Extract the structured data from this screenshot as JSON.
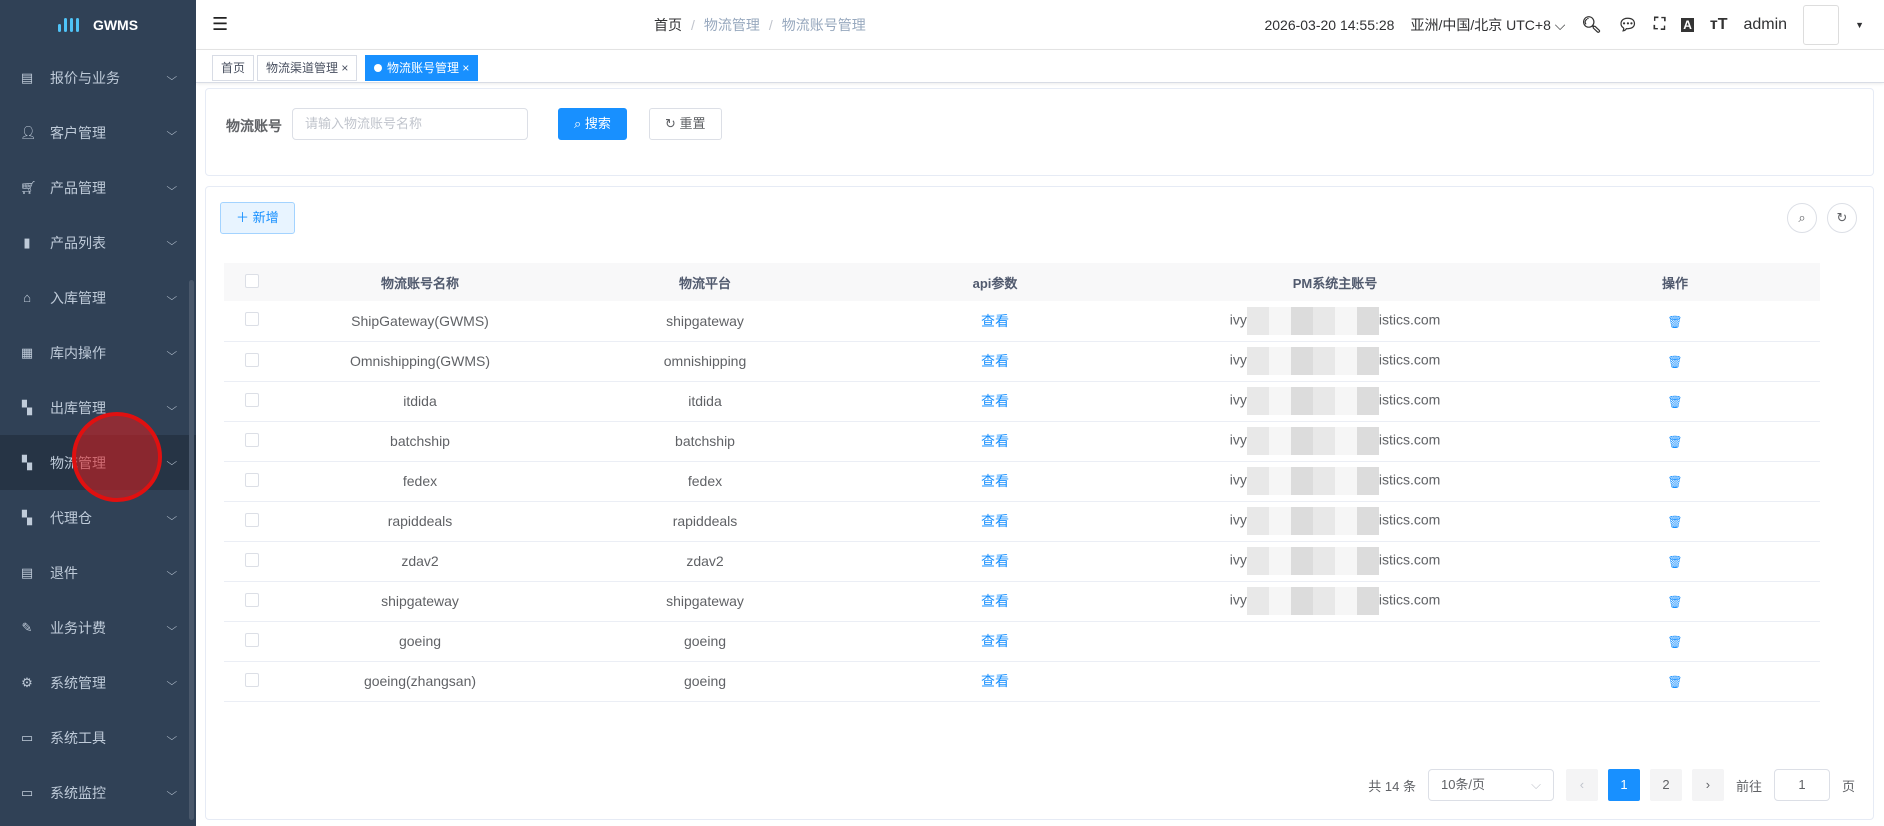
{
  "app": {
    "name": "GWMS"
  },
  "sidebar": {
    "items": [
      {
        "label": "报价与业务",
        "icon": "quote-icon"
      },
      {
        "label": "客户管理",
        "icon": "user-icon"
      },
      {
        "label": "产品管理",
        "icon": "cart-icon"
      },
      {
        "label": "产品列表",
        "icon": "book-icon"
      },
      {
        "label": "入库管理",
        "icon": "home-icon"
      },
      {
        "label": "库内操作",
        "icon": "grid-icon"
      },
      {
        "label": "出库管理",
        "icon": "apps-icon"
      },
      {
        "label": "物流管理",
        "icon": "apps-icon"
      },
      {
        "label": "代理仓",
        "icon": "apps-icon"
      },
      {
        "label": "退件",
        "icon": "return-icon"
      },
      {
        "label": "业务计费",
        "icon": "edit-icon"
      },
      {
        "label": "系统管理",
        "icon": "gear-icon"
      },
      {
        "label": "系统工具",
        "icon": "toolbox-icon"
      },
      {
        "label": "系统监控",
        "icon": "monitor-icon"
      }
    ]
  },
  "header": {
    "breadcrumb": [
      "首页",
      "物流管理",
      "物流账号管理"
    ],
    "datetime": "2026-03-20 14:55:28",
    "timezone": "亚洲/中国/北京 UTC+8",
    "user": "admin"
  },
  "tabs": [
    {
      "label": "首页"
    },
    {
      "label": "物流渠道管理"
    },
    {
      "label": "物流账号管理"
    }
  ],
  "search": {
    "label": "物流账号",
    "placeholder": "请输入物流账号名称",
    "search_btn": "搜索",
    "reset_btn": "重置"
  },
  "toolbar": {
    "add_btn": "新增"
  },
  "table": {
    "columns": [
      "物流账号名称",
      "物流平台",
      "api参数",
      "PM系统主账号",
      "操作"
    ],
    "rows": [
      {
        "name": "ShipGateway(GWMS)",
        "platform": "shipgateway",
        "api": "查看",
        "pm_prefix": "ivy",
        "pm_suffix": "istics.com"
      },
      {
        "name": "Omnishipping(GWMS)",
        "platform": "omnishipping",
        "api": "查看",
        "pm_prefix": "ivy",
        "pm_suffix": "istics.com"
      },
      {
        "name": "itdida",
        "platform": "itdida",
        "api": "查看",
        "pm_prefix": "ivy",
        "pm_suffix": "istics.com"
      },
      {
        "name": "batchship",
        "platform": "batchship",
        "api": "查看",
        "pm_prefix": "ivy",
        "pm_suffix": "istics.com"
      },
      {
        "name": "fedex",
        "platform": "fedex",
        "api": "查看",
        "pm_prefix": "ivy",
        "pm_suffix": "istics.com"
      },
      {
        "name": "rapiddeals",
        "platform": "rapiddeals",
        "api": "查看",
        "pm_prefix": "ivy",
        "pm_suffix": "istics.com"
      },
      {
        "name": "zdav2",
        "platform": "zdav2",
        "api": "查看",
        "pm_prefix": "ivy",
        "pm_suffix": "istics.com"
      },
      {
        "name": "shipgateway",
        "platform": "shipgateway",
        "api": "查看",
        "pm_prefix": "ivy",
        "pm_suffix": "istics.com"
      },
      {
        "name": "goeing",
        "platform": "goeing",
        "api": "查看",
        "pm_prefix": "",
        "pm_suffix": ""
      },
      {
        "name": "goeing(zhangsan)",
        "platform": "goeing",
        "api": "查看",
        "pm_prefix": "",
        "pm_suffix": ""
      }
    ]
  },
  "pagination": {
    "total": "共 14 条",
    "page_size": "10条/页",
    "pages": [
      "1",
      "2"
    ],
    "current": 1,
    "goto_label": "前往",
    "goto_value": "1",
    "page_unit": "页"
  }
}
